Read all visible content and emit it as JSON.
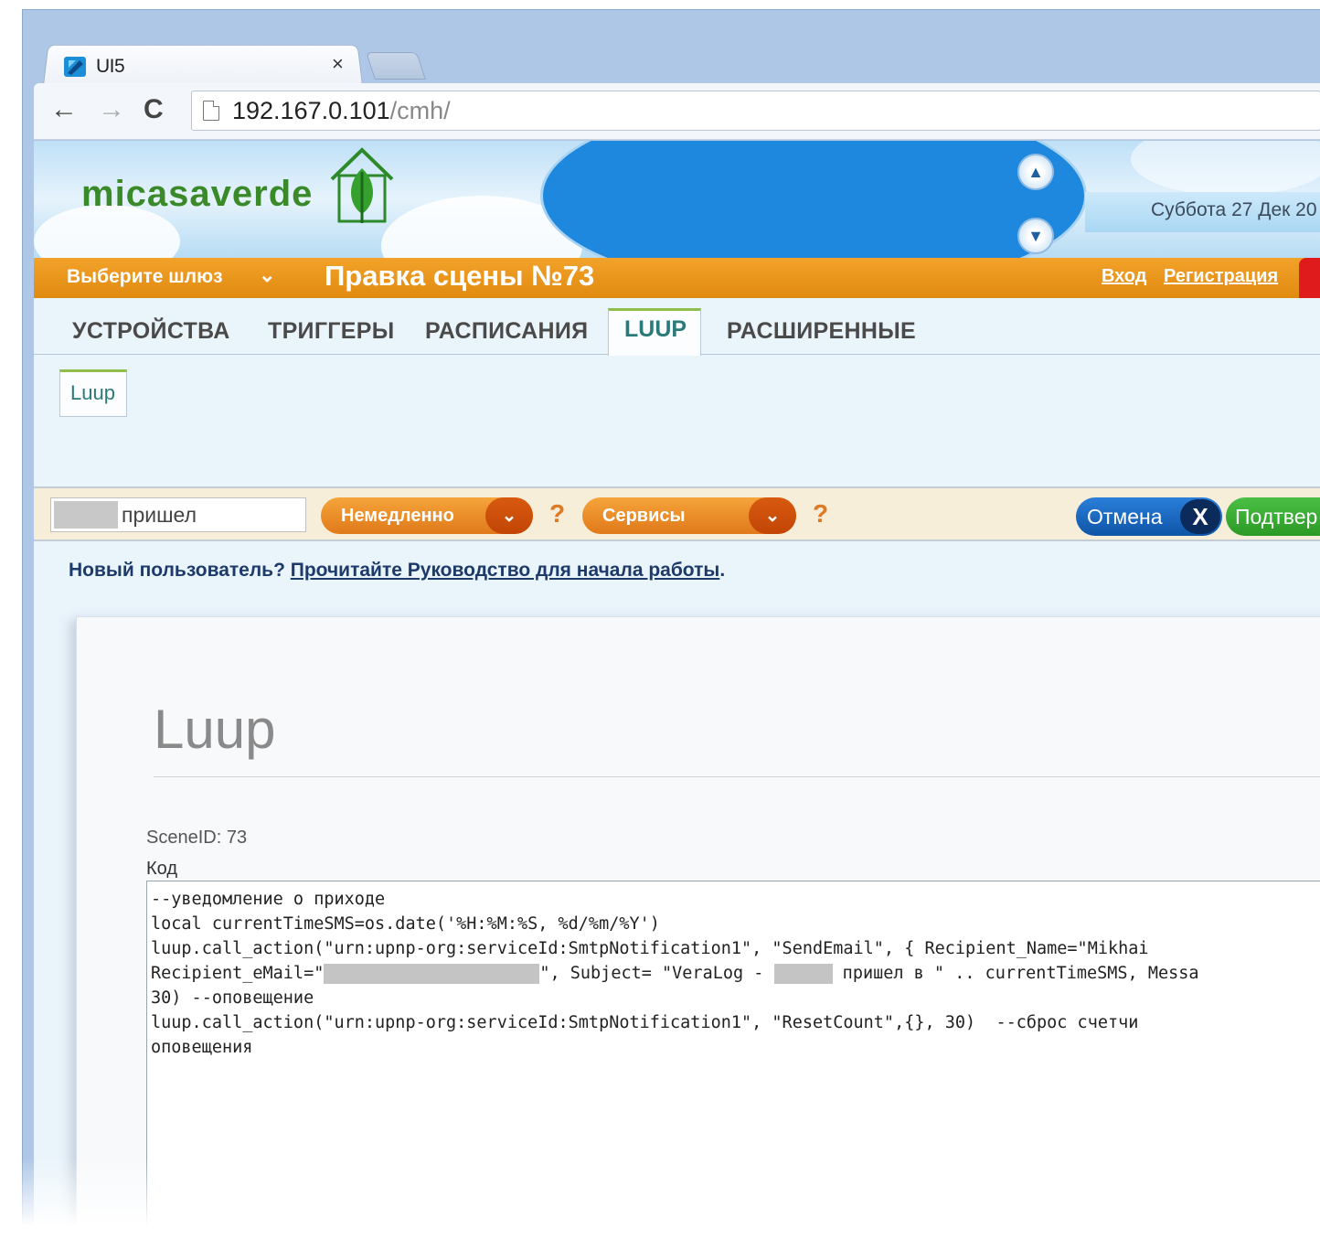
{
  "browser": {
    "tab_title": "UI5",
    "tab_close": "×",
    "url_host": "192.167.0.101",
    "url_path": "/cmh/",
    "back_icon": "←",
    "forward_icon": "→",
    "reload_icon": "C"
  },
  "header": {
    "logo": "micasaverde",
    "date": "Суббота 27 Дек 20"
  },
  "orangebar": {
    "gateway_label": "Выберите шлюз",
    "scene_title": "Правка сцены №73",
    "login": "Вход",
    "register": "Регистрация"
  },
  "tabs": [
    "УСТРОЙСТВА",
    "ТРИГГЕРЫ",
    "РАСПИСАНИЯ",
    "LUUP",
    "РАСШИРЕННЫЕ"
  ],
  "subtab": "Luup",
  "actionbar": {
    "name_value": "пришел",
    "immediate": "Немедленно",
    "services": "Сервисы",
    "help": "?",
    "cancel": "Отмена",
    "cancel_x": "X",
    "confirm": "Подтвер"
  },
  "newuser": {
    "prefix": "Новый пользователь? ",
    "link": "Прочитайте Руководство для начала работы",
    "suffix": "."
  },
  "card": {
    "title": "Luup",
    "scene_id": "SceneID: 73",
    "code_label": "Код",
    "code_lines": [
      "--уведомление о приходе",
      "local currentTimeSMS=os.date('%H:%M:%S, %d/%m/%Y')",
      "luup.call_action(\"urn:upnp-org:serviceId:SmtpNotification1\", \"SendEmail\", { Recipient_Name=\"Mikhai",
      "Recipient_eMail=\"",
      "\", Subject= \"VeraLog - ",
      " пришел в \" .. currentTimeSMS, Messa",
      "30) --оповещение",
      "luup.call_action(\"urn:upnp-org:serviceId:SmtpNotification1\", \"ResetCount\",{}, 30)  --сброс счетчи",
      "оповещения"
    ]
  }
}
